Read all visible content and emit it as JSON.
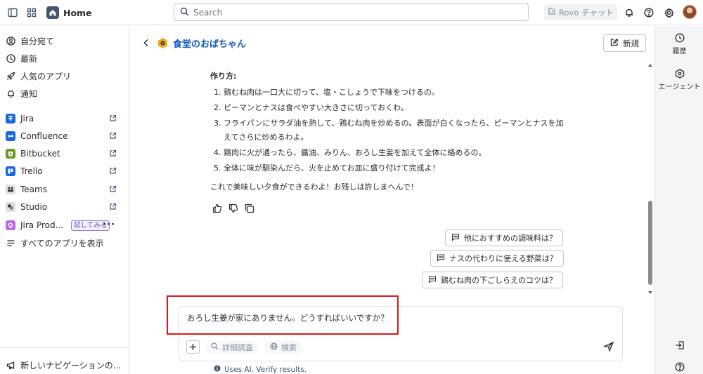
{
  "topbar": {
    "home_label": "Home",
    "search_placeholder": "Search",
    "rovo_label": "Rovo チャット"
  },
  "sidebar": {
    "nav": [
      {
        "label": "自分宛て",
        "icon": "user-circle-icon"
      },
      {
        "label": "最新",
        "icon": "clock-icon"
      },
      {
        "label": "人気のアプリ",
        "icon": "rocket-icon"
      },
      {
        "label": "通知",
        "icon": "bell-icon"
      }
    ],
    "apps": [
      {
        "label": "Jira",
        "color": "#1868db"
      },
      {
        "label": "Confluence",
        "color": "#1868db"
      },
      {
        "label": "Bitbucket",
        "color": "#6a9a23"
      },
      {
        "label": "Trello",
        "color": "#1868db"
      },
      {
        "label": "Teams",
        "color": "#dddee1"
      },
      {
        "label": "Studio",
        "color": "#dddee1"
      }
    ],
    "jira_prod": {
      "label": "Jira Prod...",
      "badge": "試してみる",
      "color": "#bf63f3"
    },
    "all_apps": "すべてのアプリを表示",
    "new_nav": "新しいナビゲーションの..."
  },
  "chat": {
    "agent_name": "食堂のおばちゃん",
    "new_button": "新規",
    "heading": "作り方:",
    "steps": [
      "鶏むね肉は一口大に切って、塩・こしょうで下味をつけるの。",
      "ピーマンとナスは食べやすい大きさに切っておくわ。",
      "フライパンにサラダ油を熱して、鶏むね肉を炒めるの。表面が白くなったら、ピーマンとナスを加",
      "鶏肉に火が通ったら、醤油、みりん、おろし生姜を加えて全体に絡めるの。",
      "全体に味が馴染んだら、火を止めてお皿に盛り付けて完成よ！"
    ],
    "step3_cont": "えてさらに炒めるわよ。",
    "closing": "これで美味しい夕食ができるわよ！お残しは許しまへんで！",
    "suggestions": [
      "他におすすめの調味料は？",
      "ナスの代わりに使える野菜は？",
      "鶏むね肉の下ごしらえのコツは？"
    ],
    "composer_text": "おろし生姜が家にありません。どうすればいいですか？",
    "deep_research": "詳細調査",
    "search_pill": "検索",
    "ai_note": "Uses AI. Verify results."
  },
  "rail": {
    "history": "履歴",
    "agents": "エージェント"
  }
}
